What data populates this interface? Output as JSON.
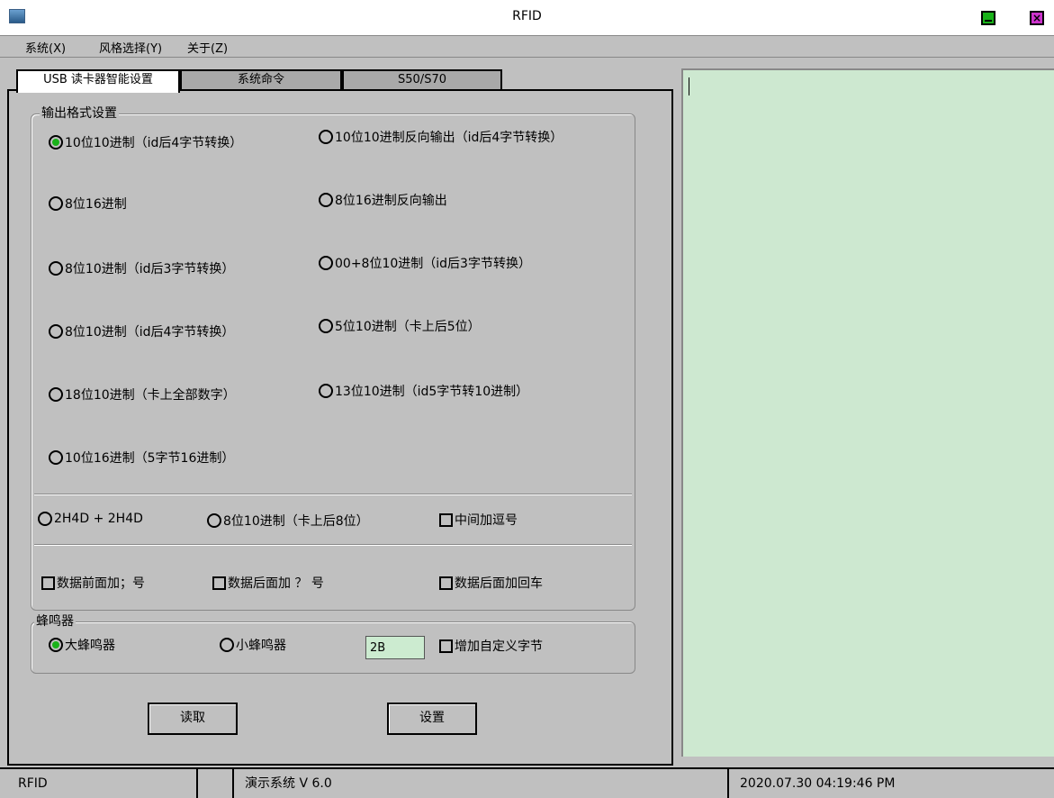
{
  "window": {
    "title": "RFID"
  },
  "menu": {
    "items": [
      "系统(X)",
      "风格选择(Y)",
      "关于(Z)"
    ]
  },
  "tabs": [
    "USB 读卡器智能设置",
    "系统命令",
    "S50/S70"
  ],
  "output_group": {
    "label": "输出格式设置",
    "options_left": [
      "10位10进制（id后4字节转换）",
      "8位16进制",
      "8位10进制（id后3字节转换）",
      "8位10进制（id后4字节转换）",
      "18位10进制（卡上全部数字）",
      "10位16进制（5字节16进制）"
    ],
    "options_right": [
      "10位10进制反向输出（id后4字节转换）",
      "8位16进制反向输出",
      "00+8位10进制（id后3字节转换）",
      "5位10进制（卡上后5位）",
      "13位10进制（id5字节转10进制）"
    ],
    "selected_index": 0,
    "row2": {
      "opt1": "2H4D + 2H4D",
      "opt2": "8位10进制（卡上后8位）",
      "check": "中间加逗号"
    },
    "row3": {
      "check1": "数据前面加；号",
      "check2": "数据后面加 ？ 号",
      "check3": "数据后面加回车"
    }
  },
  "buzzer_group": {
    "label": "蜂鸣器",
    "big": "大蜂鸣器",
    "small": "小蜂鸣器",
    "byte_value": "2B",
    "custom_check": "增加自定义字节"
  },
  "buttons": {
    "read": "读取",
    "set": "设置"
  },
  "output_area": {
    "text": ""
  },
  "status": {
    "left": "RFID",
    "middle": "",
    "version": "演示系统  V 6.0",
    "datetime": "2020.07.30   04:19:46 PM"
  },
  "colors": {
    "selected_radio": "#19b219",
    "output_bg": "#cde8d0",
    "minimize": "#19b219",
    "close": "#cc33cc"
  }
}
